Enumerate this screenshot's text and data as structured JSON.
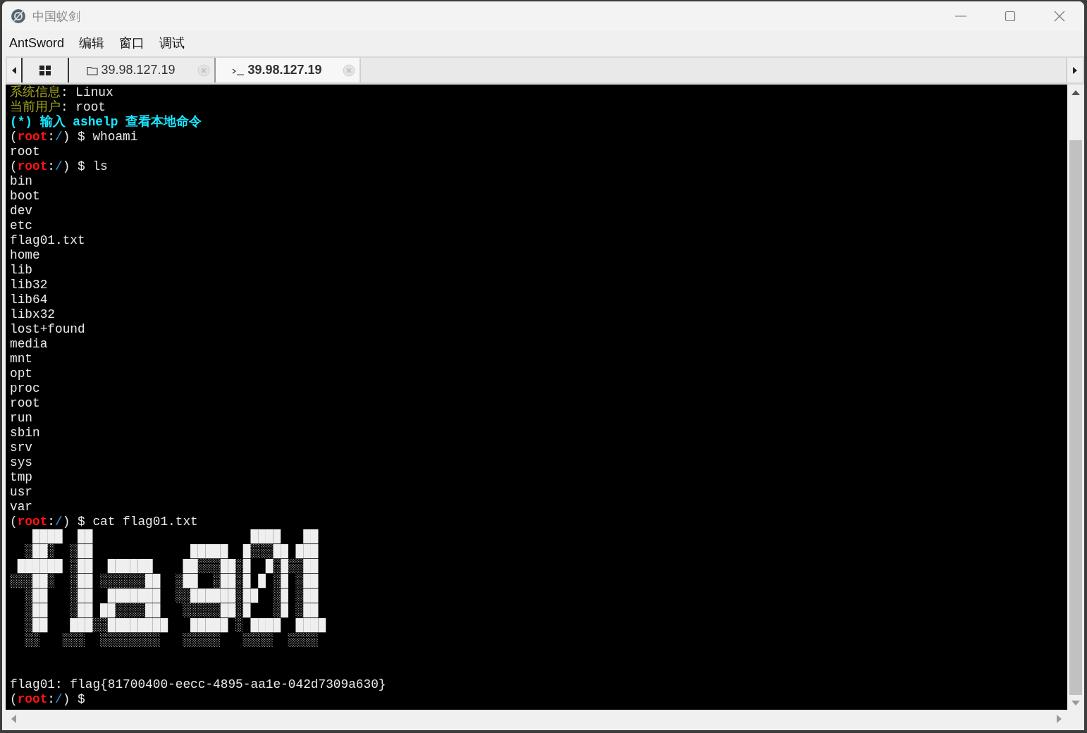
{
  "window": {
    "title": "中国蚁剑"
  },
  "menu": [
    {
      "label": "AntSword"
    },
    {
      "label": "编辑"
    },
    {
      "label": "窗口"
    },
    {
      "label": "调试"
    }
  ],
  "tabs": [
    {
      "kind": "home",
      "selected": false
    },
    {
      "kind": "files",
      "label": "39.98.127.19",
      "selected": false
    },
    {
      "kind": "terminal",
      "label": "39.98.127.19",
      "selected": true
    }
  ],
  "terminal": {
    "lines": [
      {
        "kind": "info",
        "label": "系统信息",
        "colon": ":",
        "value": "Linux"
      },
      {
        "kind": "info",
        "label": "当前用户",
        "colon": ":",
        "value": "root"
      },
      {
        "kind": "hint",
        "text": "(*) 输入 ashelp 查看本地命令"
      },
      {
        "kind": "prompt",
        "open": "(",
        "user": "root",
        "colon": ":",
        "path": "/",
        "close": ")",
        "symbol": "$",
        "command": "whoami"
      },
      {
        "kind": "output",
        "text": "root"
      },
      {
        "kind": "prompt",
        "open": "(",
        "user": "root",
        "colon": ":",
        "path": "/",
        "close": ")",
        "symbol": "$",
        "command": "ls"
      },
      {
        "kind": "output",
        "text": "bin"
      },
      {
        "kind": "output",
        "text": "boot"
      },
      {
        "kind": "output",
        "text": "dev"
      },
      {
        "kind": "output",
        "text": "etc"
      },
      {
        "kind": "output",
        "text": "flag01.txt"
      },
      {
        "kind": "output",
        "text": "home"
      },
      {
        "kind": "output",
        "text": "lib"
      },
      {
        "kind": "output",
        "text": "lib32"
      },
      {
        "kind": "output",
        "text": "lib64"
      },
      {
        "kind": "output",
        "text": "libx32"
      },
      {
        "kind": "output",
        "text": "lost+found"
      },
      {
        "kind": "output",
        "text": "media"
      },
      {
        "kind": "output",
        "text": "mnt"
      },
      {
        "kind": "output",
        "text": "opt"
      },
      {
        "kind": "output",
        "text": "proc"
      },
      {
        "kind": "output",
        "text": "root"
      },
      {
        "kind": "output",
        "text": "run"
      },
      {
        "kind": "output",
        "text": "sbin"
      },
      {
        "kind": "output",
        "text": "srv"
      },
      {
        "kind": "output",
        "text": "sys"
      },
      {
        "kind": "output",
        "text": "tmp"
      },
      {
        "kind": "output",
        "text": "usr"
      },
      {
        "kind": "output",
        "text": "var"
      },
      {
        "kind": "prompt",
        "open": "(",
        "user": "root",
        "colon": ":",
        "path": "/",
        "close": ")",
        "symbol": "$",
        "command": "cat flag01.txt"
      },
      {
        "kind": "art",
        "text": "   ████  ██                     ████   ██"
      },
      {
        "kind": "art",
        "text": "  ░██░  ░██             █████  █░░░██ ███"
      },
      {
        "kind": "art",
        "text": " ██████ ░██  ██████    ██░░░██░█  █░█░░██"
      },
      {
        "kind": "art",
        "text": "░░░██░  ░██ ░░░░░░██  ░██  ░██░█ █ ░█ ░██"
      },
      {
        "kind": "art",
        "text": "  ░██   ░██  ███████  ░░██████░██  ░█ ░██"
      },
      {
        "kind": "art",
        "text": "  ░██   ░██ ██░░░░██   ░░░░░██░█   ░█ ░██"
      },
      {
        "kind": "art",
        "text": "  ░██   ███░░████████   █████ ░ ████  ████"
      },
      {
        "kind": "art",
        "text": "  ░░   ░░░  ░░░░░░░░   ░░░░░   ░░░░  ░░░░"
      },
      {
        "kind": "blank"
      },
      {
        "kind": "blank"
      },
      {
        "kind": "output",
        "text": "flag01: flag{81700400-eecc-4895-aa1e-042d7309a630}"
      },
      {
        "kind": "prompt",
        "open": "(",
        "user": "root",
        "colon": ":",
        "path": "/",
        "close": ")",
        "symbol": "$"
      }
    ]
  }
}
